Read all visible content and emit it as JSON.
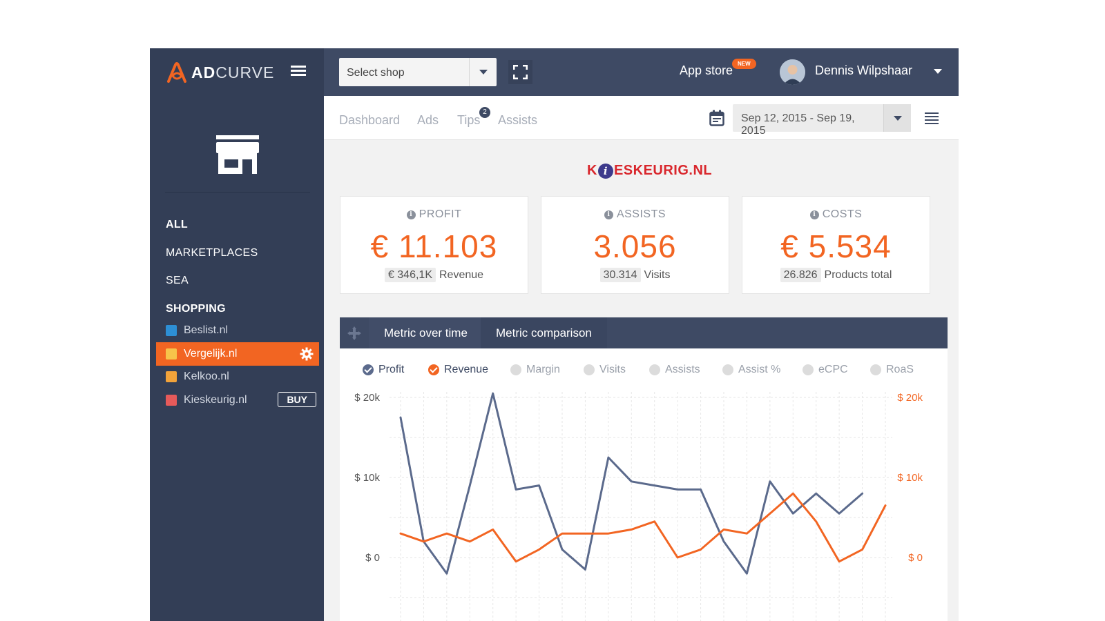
{
  "app": {
    "logo_bold": "AD",
    "logo_light": "CURVE",
    "shop_select": "Select shop",
    "app_store": "App store",
    "new_badge": "NEW",
    "user_name": "Dennis Wilpshaar"
  },
  "sidebar": {
    "categories": [
      "ALL",
      "MARKETPLACES",
      "SEA",
      "SHOPPING"
    ],
    "channels": [
      {
        "label": "Beslist.nl",
        "icon": "beslist-icon",
        "color": "#2d8fd5"
      },
      {
        "label": "Vergelijk.nl",
        "icon": "vergelijk-icon",
        "color": "#f7c34a",
        "active": true
      },
      {
        "label": "Kelkoo.nl",
        "icon": "kelkoo-icon",
        "color": "#f2a33a"
      },
      {
        "label": "Kieskeurig.nl",
        "icon": "kieskeurig-icon",
        "color": "#e65a5a",
        "action": "BUY"
      }
    ]
  },
  "subnav": {
    "tabs": [
      "Dashboard",
      "Ads",
      "Tips",
      "Assists"
    ],
    "tips_count": "2",
    "date_range": "Sep 12, 2015 - Sep 19, 2015"
  },
  "shop_logo": {
    "prefix": "K",
    "dot": "i",
    "suffix": "ESKEURIG.NL"
  },
  "kpis": [
    {
      "label": "PROFIT",
      "value": "€ 11.103",
      "chip": "€ 346,1K",
      "sub": "Revenue"
    },
    {
      "label": "ASSISTS",
      "value": "3.056",
      "chip": "30.314",
      "sub": "Visits"
    },
    {
      "label": "COSTS",
      "value": "€ 5.534",
      "chip": "26.826",
      "sub": "Products total"
    }
  ],
  "chart_tabs": [
    "Metric over time",
    "Metric comparison"
  ],
  "metrics": [
    {
      "label": "Profit",
      "state": "on-blue"
    },
    {
      "label": "Revenue",
      "state": "on-orange"
    },
    {
      "label": "Margin",
      "state": "off"
    },
    {
      "label": "Visits",
      "state": "off"
    },
    {
      "label": "Assists",
      "state": "off"
    },
    {
      "label": "Assist %",
      "state": "off"
    },
    {
      "label": "eCPC",
      "state": "off"
    },
    {
      "label": "RoaS",
      "state": "off"
    }
  ],
  "colors": {
    "accent": "#f26522",
    "navy": "#3e4a64",
    "profit_line": "#5b6a8c"
  },
  "chart_data": {
    "type": "line",
    "x": [
      1,
      2,
      3,
      4,
      5,
      6,
      7,
      8,
      9,
      10,
      11,
      12,
      13,
      14,
      15,
      16,
      17,
      18,
      19,
      20,
      21,
      22
    ],
    "series": [
      {
        "name": "Profit",
        "axis": "left",
        "color": "#5b6a8c",
        "values": [
          17500,
          2000,
          -2000,
          9000,
          20500,
          8500,
          9000,
          1000,
          -1500,
          12500,
          9500,
          9000,
          8500,
          8500,
          2000,
          -2000,
          9500,
          5500,
          8000,
          5500,
          8000,
          null
        ]
      },
      {
        "name": "Revenue",
        "axis": "right",
        "color": "#f26522",
        "values": [
          3000,
          2000,
          3000,
          2000,
          3500,
          -500,
          1000,
          3000,
          3000,
          3000,
          3500,
          4500,
          0,
          1000,
          3500,
          3000,
          5500,
          8000,
          4500,
          -500,
          1000,
          6500
        ]
      }
    ],
    "y_left_ticks": [
      "$ 20k",
      "$ 10k",
      "$ 0"
    ],
    "y_right_ticks": [
      "$ 20k",
      "$ 10k",
      "$ 0"
    ],
    "ylim": [
      -5000,
      25000
    ],
    "grid": true
  }
}
